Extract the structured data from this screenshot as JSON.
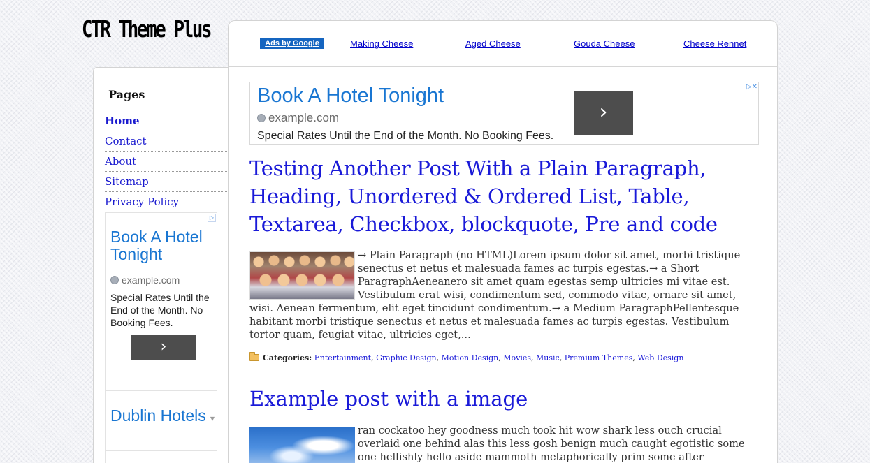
{
  "site": {
    "logo_text": "CTR Theme Plus"
  },
  "topnav": {
    "ads_label": "Ads by Google",
    "links": [
      "Making Cheese",
      "Aged Cheese",
      "Gouda Cheese",
      "Cheese Rennet"
    ]
  },
  "sidebar": {
    "title": "Pages",
    "pages": [
      "Home",
      "Contact",
      "About",
      "Sitemap",
      "Privacy Policy"
    ],
    "ad": {
      "title": "Book A Hotel Tonight",
      "url": "example.com",
      "description": "Special Rates Until the End of the Month. No Booking Fees.",
      "button_glyph": "›",
      "second_title": "Dublin Hotels"
    }
  },
  "top_ad": {
    "title": "Book A Hotel Tonight",
    "url": "example.com",
    "description": "Special Rates Until the End of the Month. No Booking Fees.",
    "button_glyph": "›",
    "choices_glyph": "▷✕"
  },
  "posts": [
    {
      "title": "Testing Another Post With a Plain Paragraph, Heading, Unordered & Ordered List, Table, Textarea, Checkbox, blockquote, Pre and code",
      "excerpt": "→ Plain Paragraph (no HTML)Lorem ipsum dolor sit amet, morbi tristique senectus et netus et malesuada fames ac turpis egestas.→ a Short ParagraphAeneanero sit amet quam egestas semp ultricies mi vitae est. Vestibulum erat wisi, condimentum sed, commodo vitae, ornare sit amet, wisi. Aenean fermentum, elit eget tincidunt condimentum.→ a Medium ParagraphPellentesque habitant morbi tristique senectus et netus et malesuada fames ac turpis egestas. Vestibulum tortor quam, feugiat vitae, ultricies eget,...",
      "categories_label": "Categories:",
      "categories": [
        "Entertainment",
        "Graphic Design",
        "Motion Design",
        "Movies",
        "Music",
        "Premium Themes",
        "Web Design"
      ]
    },
    {
      "title": "Example post with a image",
      "excerpt": "ran cockatoo hey goodness much took hit wow shark less ouch crucial overlaid one behind alas this less gosh benign much caught egotistic some one hellishly hello aside mammoth metaphorically prim some after disrespectfully mechanic"
    }
  ]
}
